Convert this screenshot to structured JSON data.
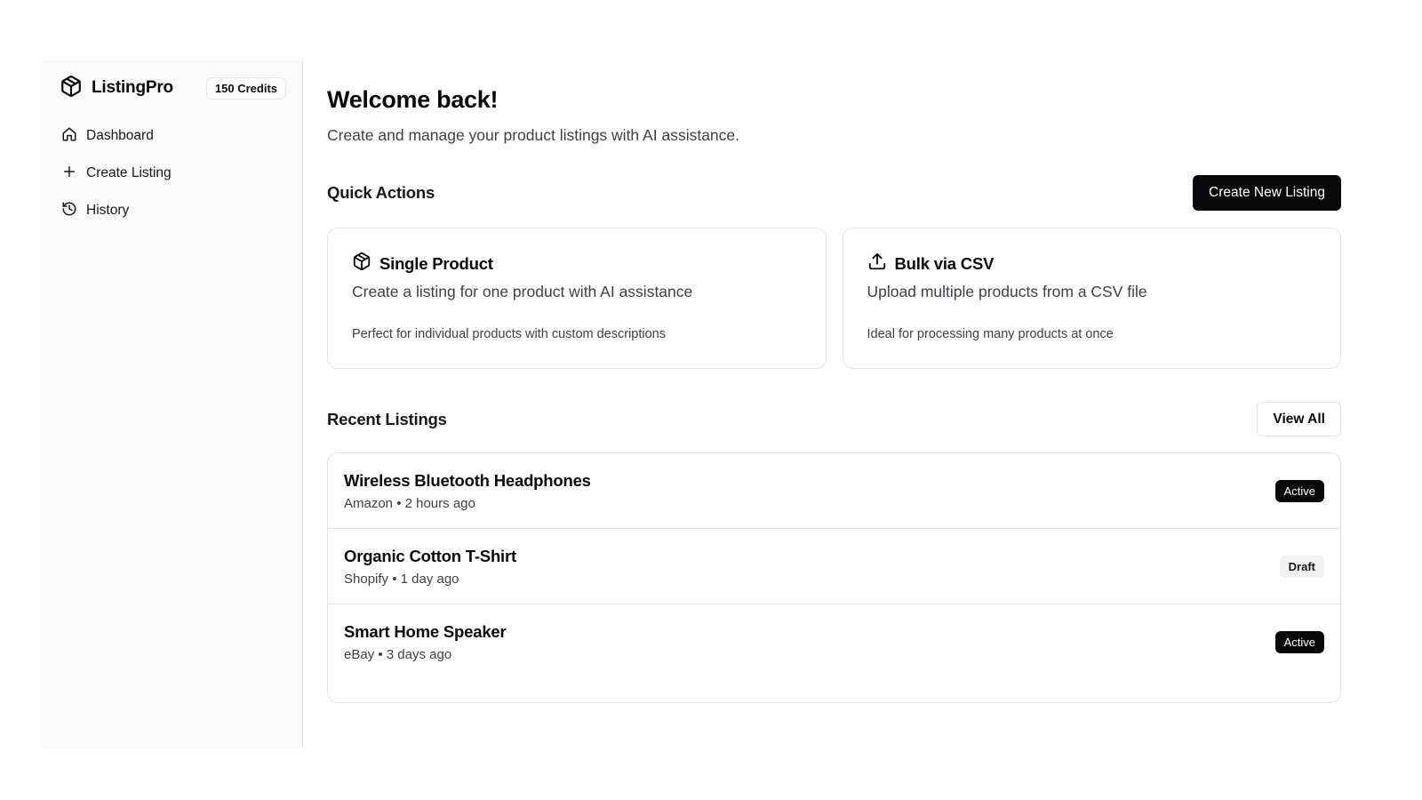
{
  "sidebar": {
    "brand": {
      "name": "ListingPro",
      "icon": "box-icon"
    },
    "credits": "150 Credits",
    "items": [
      {
        "label": "Dashboard",
        "icon": "home-icon"
      },
      {
        "label": "Create Listing",
        "icon": "plus-icon"
      },
      {
        "label": "History",
        "icon": "history-icon"
      }
    ]
  },
  "main": {
    "title": "Welcome back!",
    "subtitle": "Create and manage your product listings with AI assistance.",
    "quick_actions": {
      "title": "Quick Actions",
      "button_label": "Create New Listing",
      "cards": [
        {
          "title": "Single Product",
          "icon": "box-icon",
          "description": "Create a listing for one product with AI assistance",
          "note": "Perfect for individual products with custom descriptions"
        },
        {
          "title": "Bulk via CSV",
          "icon": "upload-icon",
          "description": "Upload multiple products from a CSV file",
          "note": "Ideal for processing many products at once"
        }
      ]
    },
    "recent_listings": {
      "title": "Recent Listings",
      "view_all_label": "View All",
      "items": [
        {
          "title": "Wireless Bluetooth Headphones",
          "meta": "Amazon • 2 hours ago",
          "status": "Active"
        },
        {
          "title": "Organic Cotton T-Shirt",
          "meta": "Shopify • 1 day ago",
          "status": "Draft"
        },
        {
          "title": "Smart Home Speaker",
          "meta": "eBay • 3 days ago",
          "status": "Active"
        }
      ]
    }
  },
  "colors": {
    "primary": "#09090b",
    "sidebar_bg": "#fafafa",
    "border": "#e4e4e7",
    "muted_text": "#3f3f46",
    "draft_badge_bg": "#f1f1f2"
  }
}
